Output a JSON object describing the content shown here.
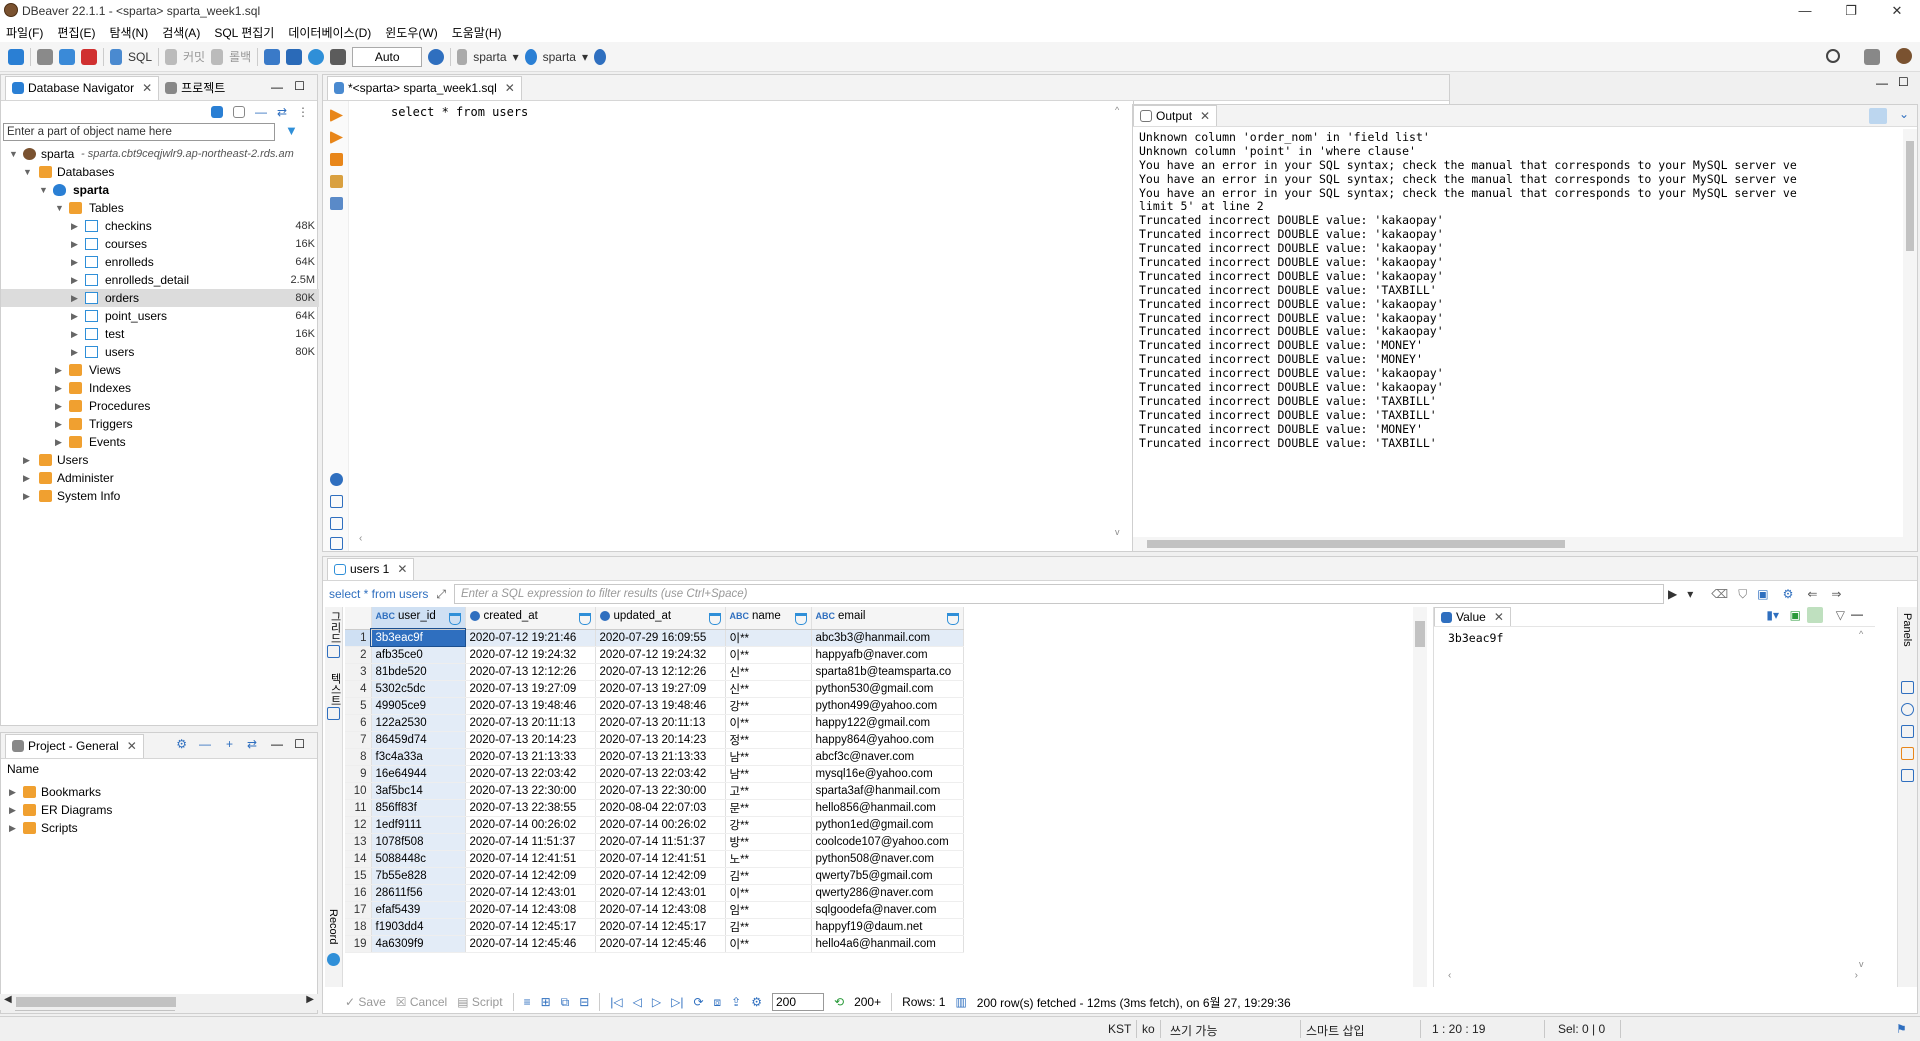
{
  "window": {
    "title": "DBeaver 22.1.1 - <sparta> sparta_week1.sql",
    "minimize": "—",
    "maximize": "❐",
    "close": "✕"
  },
  "menu": [
    "파일(F)",
    "편집(E)",
    "탐색(N)",
    "검색(A)",
    "SQL 편집기",
    "데이터베이스(D)",
    "윈도우(W)",
    "도움말(H)"
  ],
  "toolbar": {
    "sql": "SQL",
    "commit": "커밋",
    "rollback": "롤백",
    "auto": "Auto",
    "datasource": "sparta",
    "schema": "sparta"
  },
  "navigator": {
    "tab_label": "Database Navigator",
    "tab2_label": "프로젝트",
    "filter_placeholder": "Enter a part of object name here",
    "connection": "sparta",
    "connection_host": "- sparta.cbt9ceqjwlr9.ap-northeast-2.rds.am",
    "databases": "Databases",
    "schema": "sparta",
    "tables_label": "Tables",
    "tables": [
      {
        "name": "checkins",
        "size": "48K"
      },
      {
        "name": "courses",
        "size": "16K"
      },
      {
        "name": "enrolleds",
        "size": "64K"
      },
      {
        "name": "enrolleds_detail",
        "size": "2.5M"
      },
      {
        "name": "orders",
        "size": "80K"
      },
      {
        "name": "point_users",
        "size": "64K"
      },
      {
        "name": "test",
        "size": "16K"
      },
      {
        "name": "users",
        "size": "80K"
      }
    ],
    "schema_folders": [
      "Views",
      "Indexes",
      "Procedures",
      "Triggers",
      "Events"
    ],
    "root_folders": [
      "Users",
      "Administer",
      "System Info"
    ]
  },
  "project": {
    "tab_label": "Project - General",
    "column": "Name",
    "items": [
      "Bookmarks",
      "ER Diagrams",
      "Scripts"
    ]
  },
  "editor": {
    "tab_label": "*<sparta> sparta_week1.sql",
    "query": "select * from users"
  },
  "output": {
    "tab_label": "Output",
    "lines": [
      "Unknown column 'order_nom' in 'field list'",
      "Unknown column 'point' in 'where clause'",
      "You have an error in your SQL syntax; check the manual that corresponds to your MySQL server ve",
      "You have an error in your SQL syntax; check the manual that corresponds to your MySQL server ve",
      "You have an error in your SQL syntax; check the manual that corresponds to your MySQL server ve",
      "limit 5' at line 2",
      "Truncated incorrect DOUBLE value: 'kakaopay'",
      "Truncated incorrect DOUBLE value: 'kakaopay'",
      "Truncated incorrect DOUBLE value: 'kakaopay'",
      "Truncated incorrect DOUBLE value: 'kakaopay'",
      "Truncated incorrect DOUBLE value: 'kakaopay'",
      "Truncated incorrect DOUBLE value: 'TAXBILL'",
      "Truncated incorrect DOUBLE value: 'kakaopay'",
      "Truncated incorrect DOUBLE value: 'kakaopay'",
      "Truncated incorrect DOUBLE value: 'kakaopay'",
      "Truncated incorrect DOUBLE value: 'MONEY'",
      "Truncated incorrect DOUBLE value: 'MONEY'",
      "Truncated incorrect DOUBLE value: 'kakaopay'",
      "Truncated incorrect DOUBLE value: 'kakaopay'",
      "Truncated incorrect DOUBLE value: 'TAXBILL'",
      "Truncated incorrect DOUBLE value: 'TAXBILL'",
      "Truncated incorrect DOUBLE value: 'MONEY'",
      "Truncated incorrect DOUBLE value: 'TAXBILL'"
    ]
  },
  "results": {
    "tab_label": "users 1",
    "query_label": "select * from users",
    "filter_placeholder": "Enter a SQL expression to filter results (use Ctrl+Space)",
    "side_grid": "그리드",
    "side_text": "텍스트",
    "side_record": "Record",
    "columns": [
      "user_id",
      "created_at",
      "updated_at",
      "name",
      "email"
    ],
    "rows": [
      [
        "1",
        "3b3eac9f",
        "2020-07-12 19:21:46",
        "2020-07-29 16:09:55",
        "이**",
        "abc3b3@hanmail.com"
      ],
      [
        "2",
        "afb35ce0",
        "2020-07-12 19:24:32",
        "2020-07-12 19:24:32",
        "이**",
        "happyafb@naver.com"
      ],
      [
        "3",
        "81bde520",
        "2020-07-13 12:12:26",
        "2020-07-13 12:12:26",
        "신**",
        "sparta81b@teamsparta.co"
      ],
      [
        "4",
        "5302c5dc",
        "2020-07-13 19:27:09",
        "2020-07-13 19:27:09",
        "신**",
        "python530@gmail.com"
      ],
      [
        "5",
        "49905ce9",
        "2020-07-13 19:48:46",
        "2020-07-13 19:48:46",
        "강**",
        "python499@yahoo.com"
      ],
      [
        "6",
        "122a2530",
        "2020-07-13 20:11:13",
        "2020-07-13 20:11:13",
        "이**",
        "happy122@gmail.com"
      ],
      [
        "7",
        "86459d74",
        "2020-07-13 20:14:23",
        "2020-07-13 20:14:23",
        "정**",
        "happy864@yahoo.com"
      ],
      [
        "8",
        "f3c4a33a",
        "2020-07-13 21:13:33",
        "2020-07-13 21:13:33",
        "남**",
        "abcf3c@naver.com"
      ],
      [
        "9",
        "16e64944",
        "2020-07-13 22:03:42",
        "2020-07-13 22:03:42",
        "남**",
        "mysql16e@yahoo.com"
      ],
      [
        "10",
        "3af5bc14",
        "2020-07-13 22:30:00",
        "2020-07-13 22:30:00",
        "고**",
        "sparta3af@hanmail.com"
      ],
      [
        "11",
        "856ff83f",
        "2020-07-13 22:38:55",
        "2020-08-04 22:07:03",
        "문**",
        "hello856@hanmail.com"
      ],
      [
        "12",
        "1edf9111",
        "2020-07-14 00:26:02",
        "2020-07-14 00:26:02",
        "강**",
        "python1ed@gmail.com"
      ],
      [
        "13",
        "1078f508",
        "2020-07-14 11:51:37",
        "2020-07-14 11:51:37",
        "방**",
        "coolcode107@yahoo.com"
      ],
      [
        "14",
        "5088448c",
        "2020-07-14 12:41:51",
        "2020-07-14 12:41:51",
        "노**",
        "python508@naver.com"
      ],
      [
        "15",
        "7b55e828",
        "2020-07-14 12:42:09",
        "2020-07-14 12:42:09",
        "김**",
        "qwerty7b5@gmail.com"
      ],
      [
        "16",
        "28611f56",
        "2020-07-14 12:43:01",
        "2020-07-14 12:43:01",
        "이**",
        "qwerty286@naver.com"
      ],
      [
        "17",
        "efaf5439",
        "2020-07-14 12:43:08",
        "2020-07-14 12:43:08",
        "임**",
        "sqlgoodefa@naver.com"
      ],
      [
        "18",
        "f1903dd4",
        "2020-07-14 12:45:17",
        "2020-07-14 12:45:17",
        "김**",
        "happyf19@daum.net"
      ],
      [
        "19",
        "4a6309f9",
        "2020-07-14 12:45:46",
        "2020-07-14 12:45:46",
        "이**",
        "hello4a6@hanmail.com"
      ]
    ],
    "footer": {
      "save": "Save",
      "cancel": "Cancel",
      "script": "Script",
      "fetch_size": "200",
      "fetch_more": "200+",
      "rows_label": "Rows: 1",
      "fetch_status": "200 row(s) fetched - 12ms (3ms fetch), on 6월 27, 19:29:36"
    }
  },
  "value_panel": {
    "tab_label": "Value",
    "value": "3b3eac9f",
    "panels_label": "Panels"
  },
  "statusbar": {
    "tz": "KST",
    "lang": "ko",
    "mode": "쓰기 가능",
    "insert": "스마트 삽입",
    "position": "1 : 20 : 19",
    "selection": "Sel: 0 | 0"
  }
}
